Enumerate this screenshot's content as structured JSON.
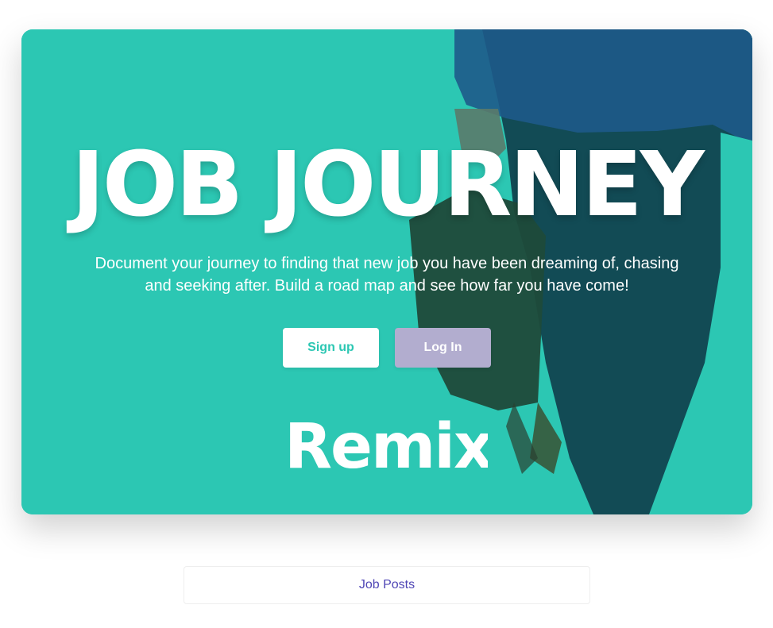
{
  "hero": {
    "title": "JOB JOURNEY",
    "description": "Document your journey to finding that new job you have been dreaming of, chasing and seeking after. Build a road map and see how far you have come!",
    "signup_label": "Sign up",
    "login_label": "Log In",
    "logo_text": "Remix",
    "background_image": "person-with-briefcase-walking"
  },
  "nav": {
    "job_posts_label": "Job Posts"
  },
  "colors": {
    "teal": "#2cc7b3",
    "lavender": "#b2adcf",
    "link": "#4f46b5"
  }
}
